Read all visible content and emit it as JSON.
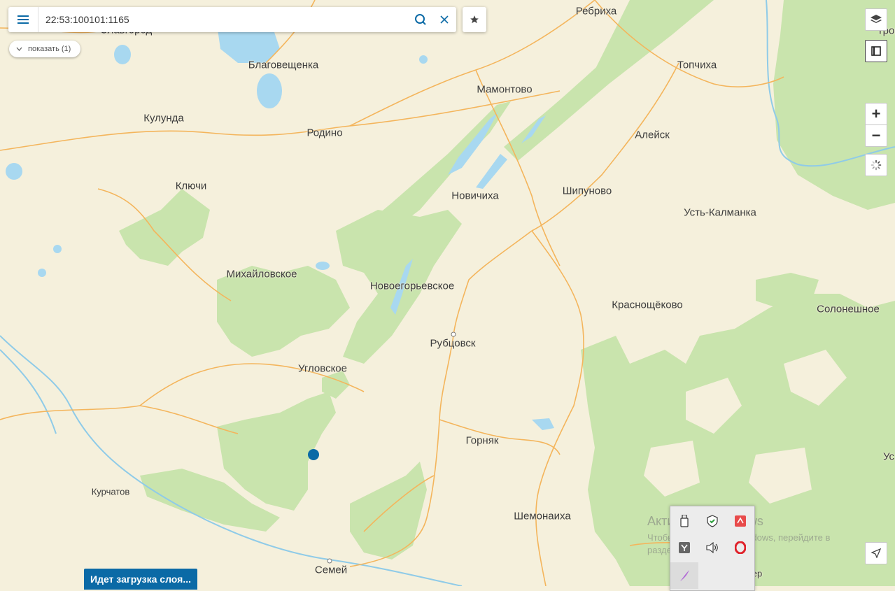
{
  "search": {
    "value": "22:53:100101:1165",
    "placeholder": ""
  },
  "show_button": {
    "label": "показать (1)"
  },
  "loading_status": "Идет загрузка слоя...",
  "zoom": {
    "in_label": "+",
    "out_label": "−"
  },
  "map_labels": [
    "Ребриха",
    "Славгород",
    "Благовещенка",
    "Топчиха",
    "Мамонтово",
    "Кулунда",
    "Родино",
    "Алейск",
    "Ключи",
    "Шипуново",
    "Новичиха",
    "Усть-Калманка",
    "Михайловское",
    "Новоегорьевское",
    "Краснощёково",
    "Солонешное",
    "Рубцовск",
    "Угловское",
    "Горняк",
    "Курчатов",
    "Шемонаиха",
    "Семей",
    "Трои",
    "Ус",
    "ер"
  ],
  "watermark": {
    "title": "Активация Windows",
    "line1": "Чтобы активировать Windows, перейдите в",
    "line2": "раздел \"Параметры\"."
  },
  "icons": {
    "menu": "hamburger-icon",
    "search": "search-icon",
    "clear": "close-icon",
    "favorite": "star-icon",
    "layers": "layers-icon",
    "ruler": "ruler-icon",
    "spinner": "spinner-icon",
    "locate": "navigation-arrow-icon"
  },
  "colors": {
    "land": "#f5f0dc",
    "forest": "#c9e4ad",
    "water": "#a8d8f0",
    "road": "#f4b55c",
    "marker": "#0b6aa6"
  }
}
